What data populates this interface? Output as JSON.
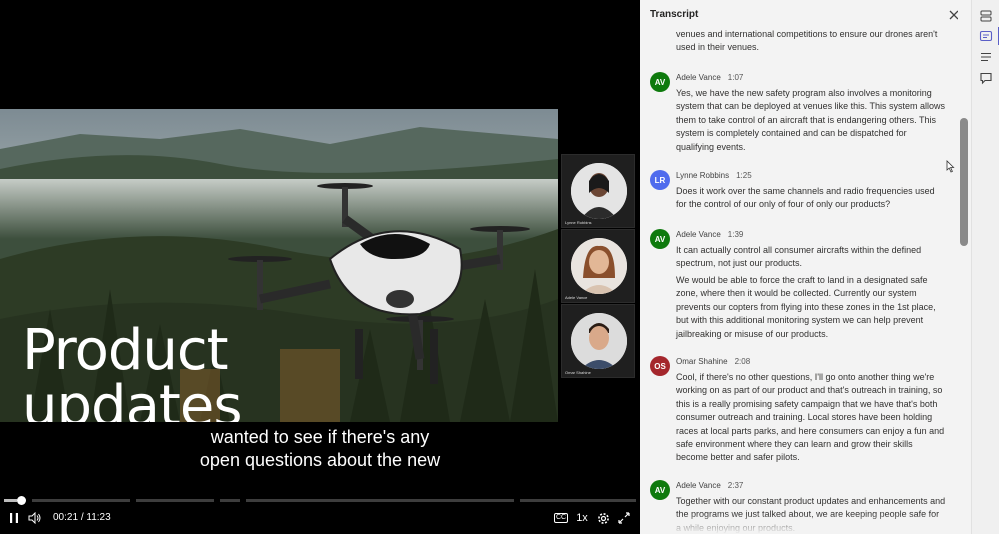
{
  "video": {
    "slide_title": "Product updates",
    "caption_line1": "wanted to see if there's any",
    "caption_line2": "open questions about the new",
    "participants": [
      {
        "name": "Lynne Robbins"
      },
      {
        "name": "Adele Vance"
      },
      {
        "name": "Omar Shahine"
      }
    ],
    "controls": {
      "current_time": "00:21",
      "separator": "/",
      "duration": "11:23",
      "speed": "1x",
      "play_pause_icon": "pause-icon",
      "volume_icon": "volume-icon",
      "cc_label": "CC",
      "settings_icon": "gear-icon",
      "fullscreen_icon": "fullscreen-icon"
    },
    "progress_fraction": 0.031
  },
  "transcript": {
    "title": "Transcript",
    "entries": [
      {
        "initials": "",
        "speaker": "",
        "time": "",
        "color": "",
        "paragraphs": [
          "venues and international competitions to ensure our drones aren't used in their venues."
        ]
      },
      {
        "initials": "AV",
        "speaker": "Adele Vance",
        "time": "1:07",
        "color": "#0e7a0d",
        "paragraphs": [
          "Yes, we have the new safety program also involves a monitoring system that can be deployed at venues like this. This system allows them to take control of an aircraft that is endangering others. This system is completely contained and can be dispatched for qualifying events."
        ]
      },
      {
        "initials": "LR",
        "speaker": "Lynne Robbins",
        "time": "1:25",
        "color": "#4f6bed",
        "paragraphs": [
          "Does it work over the same channels and radio frequencies used for the control of our only of four of only our products?"
        ]
      },
      {
        "initials": "AV",
        "speaker": "Adele Vance",
        "time": "1:39",
        "color": "#0e7a0d",
        "paragraphs": [
          "It can actually control all consumer aircrafts within the defined spectrum, not just our products.",
          "We would be able to force the craft to land in a designated safe zone, where then it would be collected. Currently our system prevents our copters from flying into these zones in the 1st place, but with this additional monitoring system we can help prevent jailbreaking or misuse of our products."
        ]
      },
      {
        "initials": "OS",
        "speaker": "Omar Shahine",
        "time": "2:08",
        "color": "#a4262c",
        "paragraphs": [
          "Cool, if there's no other questions, I'll go onto another thing we're working on as part of our product and that's outreach in training, so this is a really promising safety campaign that we have that's both consumer outreach and training. Local stores have been holding races at local parts parks, and here consumers can enjoy a fun and safe environment where they can learn and grow their skills become better and safer pilots."
        ]
      },
      {
        "initials": "AV",
        "speaker": "Adele Vance",
        "time": "2:37",
        "color": "#0e7a0d",
        "paragraphs": [
          "Together with our constant product updates and enhancements and the programs we just talked about, we are keeping people safe for a while enjoying our products."
        ]
      }
    ],
    "close_icon": "close-icon"
  },
  "rail": {
    "items": [
      "layers-icon",
      "transcript-icon",
      "chapters-icon",
      "comments-icon"
    ]
  }
}
